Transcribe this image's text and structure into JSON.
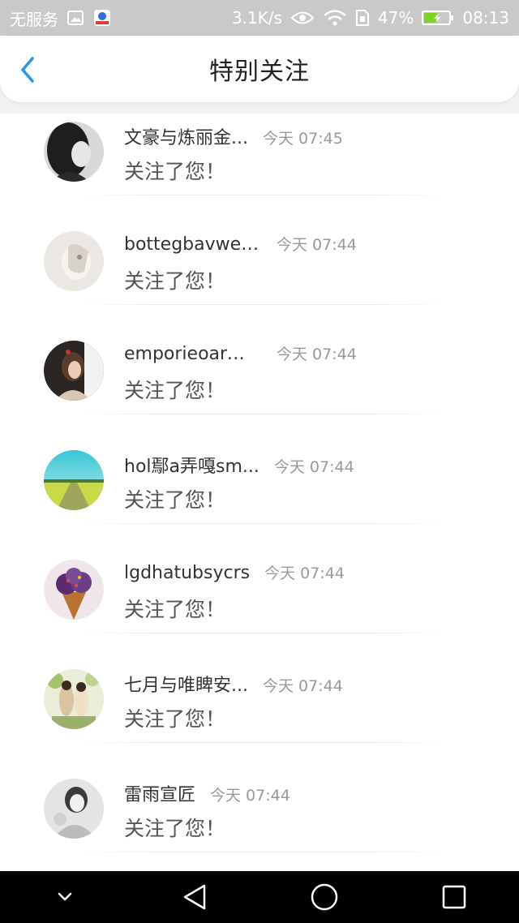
{
  "status_bar": {
    "carrier": "无服务",
    "speed": "3.1K/s",
    "battery_percent": "47%",
    "time": "08:13",
    "icons": [
      "image-icon",
      "app-badge-icon",
      "eye-icon",
      "wifi-icon",
      "sim-icon",
      "battery-icon"
    ]
  },
  "header": {
    "title": "特别关注",
    "back_icon": "chevron-left-icon",
    "accent_color": "#2196f3"
  },
  "list": {
    "items": [
      {
        "name": "文豪与炼丽金...",
        "time": "今天 07:45",
        "action": "关注了您！"
      },
      {
        "name": "bottegbavwene...",
        "time": "今天 07:44",
        "action": "关注了您！"
      },
      {
        "name": "emporieoarma...",
        "time": "今天 07:44",
        "action": "关注了您！"
      },
      {
        "name": "hol鄢a弄嘎sm...",
        "time": "今天 07:44",
        "action": "关注了您！"
      },
      {
        "name": "lgdhatubsycrs",
        "time": "今天 07:44",
        "action": "关注了您！"
      },
      {
        "name": "七月与唯睥安...",
        "time": "今天 07:44",
        "action": "关注了您！"
      },
      {
        "name": "雷雨宣匠",
        "time": "今天 07:44",
        "action": "关注了您！"
      }
    ]
  },
  "nav_bar": {
    "icons": [
      "chevron-down-icon",
      "back-triangle-icon",
      "home-circle-icon",
      "recents-square-icon"
    ]
  }
}
